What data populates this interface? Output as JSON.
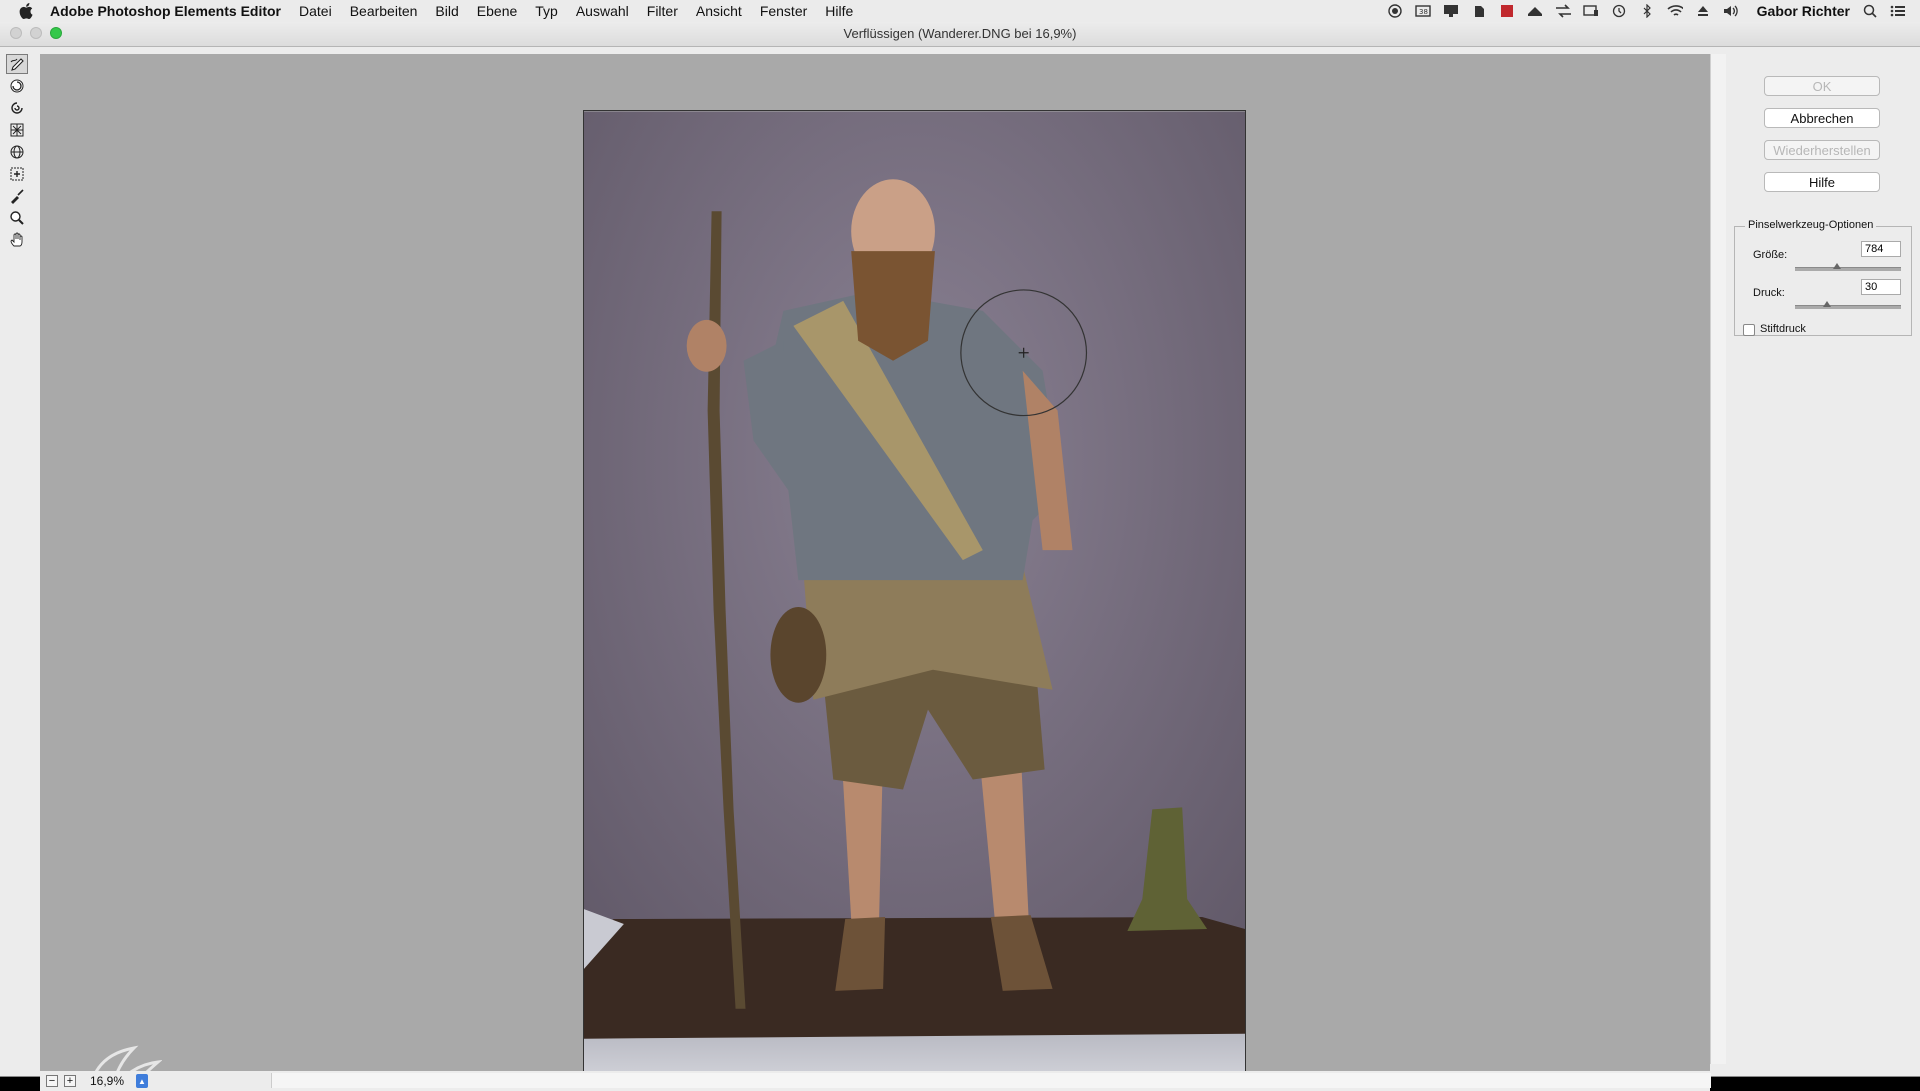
{
  "menubar": {
    "app_name": "Adobe Photoshop Elements Editor",
    "menus": [
      "Datei",
      "Bearbeiten",
      "Bild",
      "Ebene",
      "Typ",
      "Auswahl",
      "Filter",
      "Ansicht",
      "Fenster",
      "Hilfe"
    ],
    "user": "Gabor Richter"
  },
  "window": {
    "title": "Verflüssigen (Wanderer.DNG bei 16,9%)"
  },
  "tools": [
    "warp-tool",
    "twirl-clockwise-tool",
    "twirl-counterclockwise-tool",
    "pucker-tool",
    "bloat-tool",
    "shift-pixels-tool",
    "reconstruct-tool",
    "zoom-tool",
    "hand-tool"
  ],
  "panel": {
    "ok_label": "OK",
    "cancel_label": "Abbrechen",
    "restore_label": "Wiederherstellen",
    "help_label": "Hilfe",
    "options_title": "Pinselwerkzeug-Optionen",
    "size_label": "Größe:",
    "size_value": "784",
    "size_fraction": 0.4,
    "pressure_label": "Druck:",
    "pressure_value": "30",
    "pressure_fraction": 0.3,
    "stylus_label": "Stiftdruck",
    "stylus_checked": false
  },
  "status": {
    "zoom": "16,9%"
  },
  "colors": {
    "canvas_bg": "#a9a9a9",
    "accent": "#3f7ddb"
  }
}
